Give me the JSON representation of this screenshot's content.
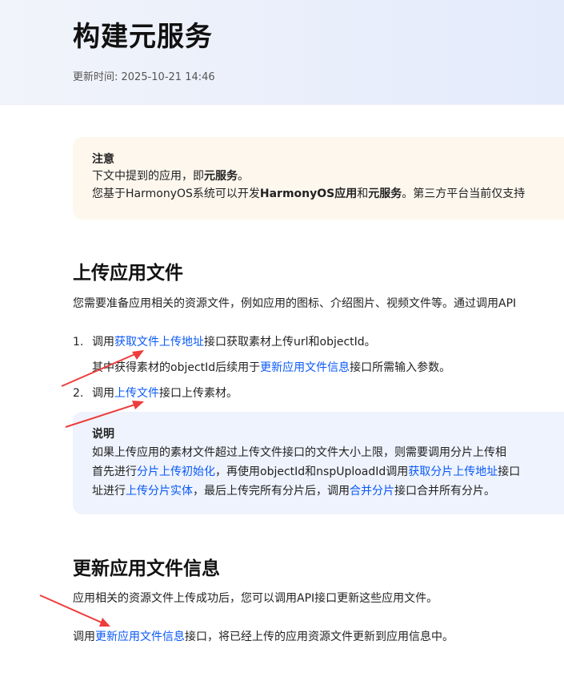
{
  "header": {
    "title": "构建元服务",
    "update_label": "更新时间: ",
    "update_time": "2025-10-21 14:46"
  },
  "note": {
    "title": "注意",
    "line1": {
      "pre": "下文中提到的应用，即",
      "bold": "元服务",
      "post": "。"
    },
    "line2": {
      "pre": "您基于HarmonyOS系统可以开发",
      "bold1": "HarmonyOS应用",
      "mid": "和",
      "bold2": "元服务",
      "post": "。第三方平台当前仅支持"
    }
  },
  "section_upload": {
    "heading": "上传应用文件",
    "intro": "您需要准备应用相关的资源文件，例如应用的图标、介绍图片、视频文件等。通过调用API",
    "steps": [
      {
        "num": "1.",
        "pre": "调用",
        "link": "获取文件上传地址",
        "post": "接口获取素材上传url和objectId。"
      },
      {
        "num": "2.",
        "pre": "调用",
        "link": "上传文件",
        "post": "接口上传素材。"
      }
    ],
    "step1_sub": {
      "pre": "其中获得素材的objectId后续用于",
      "link": "更新应用文件信息",
      "post": "接口所需输入参数。"
    }
  },
  "tip": {
    "title": "说明",
    "line1": "如果上传应用的素材文件超过上传文件接口的文件大小上限，则需要调用分片上传相",
    "line2": {
      "pre": "首先进行",
      "link1": "分片上传初始化",
      "mid": "，再使用objectId和nspUploadId调用",
      "link2": "获取分片上传地址",
      "post": "接口"
    },
    "line3": {
      "pre": "址进行",
      "link1": "上传分片实体",
      "mid": "，最后上传完所有分片后，调用",
      "link2": "合并分片",
      "post": "接口合并所有分片。"
    }
  },
  "section_update": {
    "heading": "更新应用文件信息",
    "intro": "应用相关的资源文件上传成功后，您可以调用API接口更新这些应用文件。",
    "call": {
      "pre": "调用",
      "link": "更新应用文件信息",
      "post": "接口，将已经上传的应用资源文件更新到应用信息中。"
    }
  },
  "colors": {
    "link": "#0a59f7",
    "annotation_arrow": "#ee3c3c",
    "note_bg": "#fdf7ee",
    "tip_bg": "#eef3fd"
  }
}
